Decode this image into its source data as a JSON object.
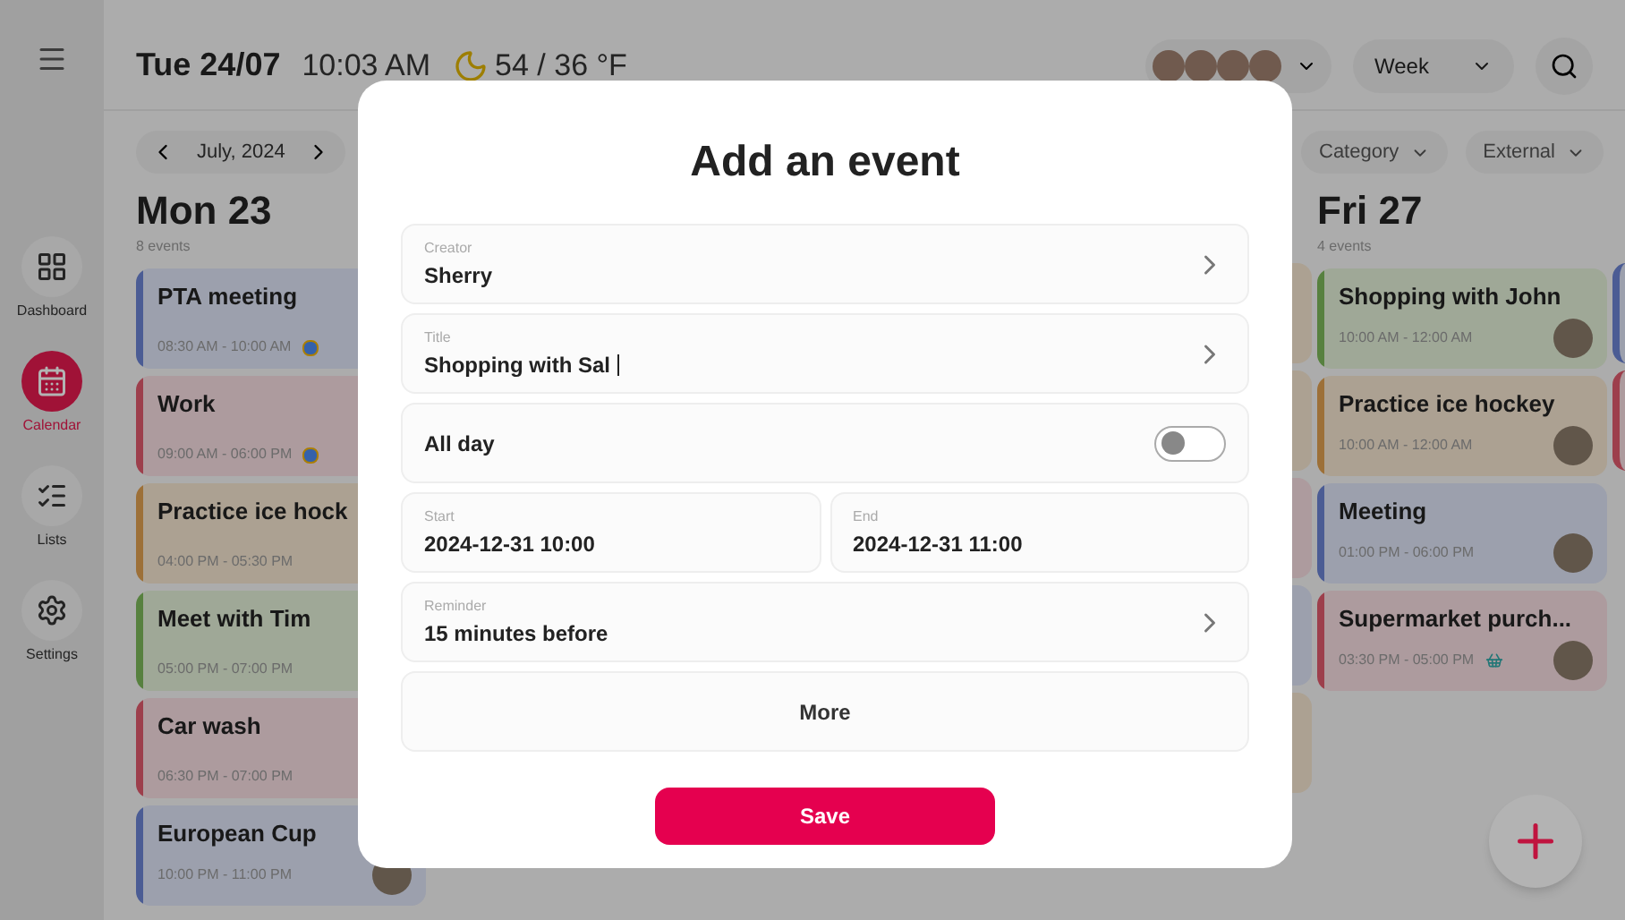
{
  "sidebar": {
    "items": [
      {
        "label": "Dashboard",
        "selected": false
      },
      {
        "label": "Calendar",
        "selected": true
      },
      {
        "label": "Lists",
        "selected": false
      },
      {
        "label": "Settings",
        "selected": false
      }
    ]
  },
  "header": {
    "date": "Tue 24/07",
    "time": "10:03 AM",
    "weather": "54 / 36 °F",
    "view": "Week"
  },
  "toolbar": {
    "month": "July, 2024",
    "filters": [
      "Category",
      "External"
    ]
  },
  "columns": [
    {
      "title": "Mon 23",
      "count": "8 events",
      "events": [
        {
          "title": "PTA meeting",
          "time": "08:30 AM - 10:00 AM",
          "color": "#4b5c94",
          "calendar_app": true,
          "avatar": false,
          "basket": false
        },
        {
          "title": "Work",
          "time": "09:00 AM - 06:00 PM",
          "color": "#9d3f4c",
          "calendar_app": true,
          "avatar": false,
          "basket": false
        },
        {
          "title": "Practice ice hock",
          "time": "04:00 PM - 05:30 PM",
          "color": "#9d7038",
          "calendar_app": false,
          "avatar": false,
          "basket": false
        },
        {
          "title": "Meet with Tim",
          "time": "05:00 PM - 07:00 PM",
          "color": "#57813f",
          "calendar_app": false,
          "avatar": false,
          "basket": false
        },
        {
          "title": "Car wash",
          "time": "06:30 PM - 07:00 PM",
          "color": "#9d3f4c",
          "calendar_app": false,
          "avatar": false,
          "basket": false
        },
        {
          "title": "European Cup",
          "time": "10:00 PM - 11:00 PM",
          "color": "#4b5c94",
          "calendar_app": false,
          "avatar": true,
          "basket": false
        }
      ]
    },
    {
      "title": "Fri 27",
      "count": "4 events",
      "events": [
        {
          "title": "Shopping with John",
          "time": "10:00 AM - 12:00 AM",
          "color": "#57813f",
          "calendar_app": false,
          "avatar": true,
          "basket": false
        },
        {
          "title": "Practice ice hockey",
          "time": "10:00 AM - 12:00 AM",
          "color": "#9d7038",
          "calendar_app": false,
          "avatar": true,
          "basket": false
        },
        {
          "title": "Meeting",
          "time": "01:00 PM - 06:00 PM",
          "color": "#4b5c94",
          "calendar_app": false,
          "avatar": true,
          "basket": false
        },
        {
          "title": "Supermarket purch...",
          "time": "03:30 PM - 05:00 PM",
          "color": "#9d3f4c",
          "calendar_app": false,
          "avatar": true,
          "basket": true
        }
      ]
    }
  ],
  "dialog": {
    "title": "Add an event",
    "fields": [
      {
        "kind": "select",
        "label": "Creator",
        "value": "Sherry"
      },
      {
        "kind": "text",
        "label": "Title",
        "value": "Shopping with Sal"
      },
      {
        "kind": "toggle",
        "label": "All day",
        "on": false
      },
      {
        "kind": "pair",
        "items": [
          {
            "label": "Start",
            "value": "2024-12-31 10:00"
          },
          {
            "label": "End",
            "value": "2024-12-31 11:00"
          }
        ]
      },
      {
        "kind": "select",
        "label": "Reminder",
        "value": "15 minutes before"
      }
    ],
    "more": "More",
    "save": "Save"
  }
}
